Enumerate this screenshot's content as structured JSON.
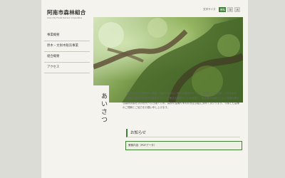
{
  "site": {
    "title": "阿南市森林組合",
    "subtitle": "Anan City Forest Owners' Cooperative"
  },
  "font_size": {
    "label": "文字サイズ",
    "options": [
      "標準",
      "中",
      "大"
    ]
  },
  "nav": {
    "items": [
      {
        "label": "事業概要"
      },
      {
        "label": "原木・文財木販売事業"
      },
      {
        "label": "組合概要"
      },
      {
        "label": "アクセス"
      }
    ]
  },
  "greeting": {
    "heading": "あいさつ",
    "paragraphs": [
      "当森林組合は徳島県の東部、阿南市を中心に地域の森林を守り育てる組織として活動しております。",
      "林業と森林の多面的な機能を活かした健全な森林づくりを目指し、組合員の皆様とともに地域の豊かな森林資源を次の世代へ引き継ぐため、森林の整備や木材の安定供給に努めてまいります。今後とも皆様のご理解とご協力をお願い申し上げます。"
    ]
  },
  "notices": {
    "heading": "お知らせ",
    "items": [
      {
        "label": "業務内容（PDFデータ）"
      }
    ]
  },
  "colors": {
    "accent": "#3f7f37",
    "background": "#dcdcd6",
    "page": "#f4f3ee"
  }
}
